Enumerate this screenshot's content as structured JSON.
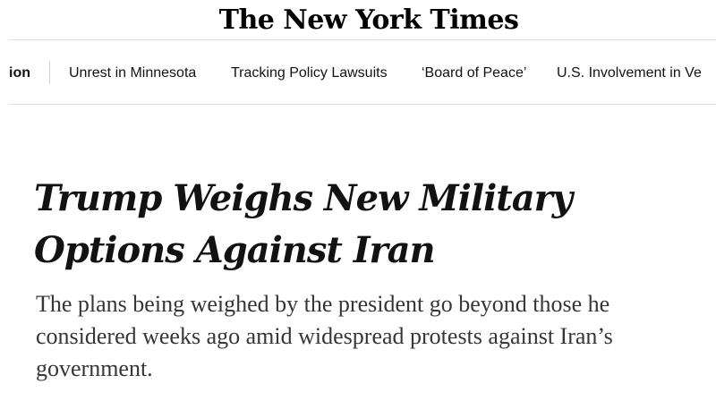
{
  "masthead": {
    "logo_text": "The New York Times"
  },
  "nav": {
    "items": [
      {
        "label": "ion"
      },
      {
        "label": "Unrest in Minnesota"
      },
      {
        "label": "Tracking Policy Lawsuits"
      },
      {
        "label": "‘Board of Peace’"
      },
      {
        "label": "U.S. Involvement in Ve"
      }
    ]
  },
  "article": {
    "headline": "Trump Weighs New Military Options Against Iran",
    "summary": "The plans being weighed by the president go beyond those he considered weeks ago amid widespread protests against Iran’s government."
  }
}
